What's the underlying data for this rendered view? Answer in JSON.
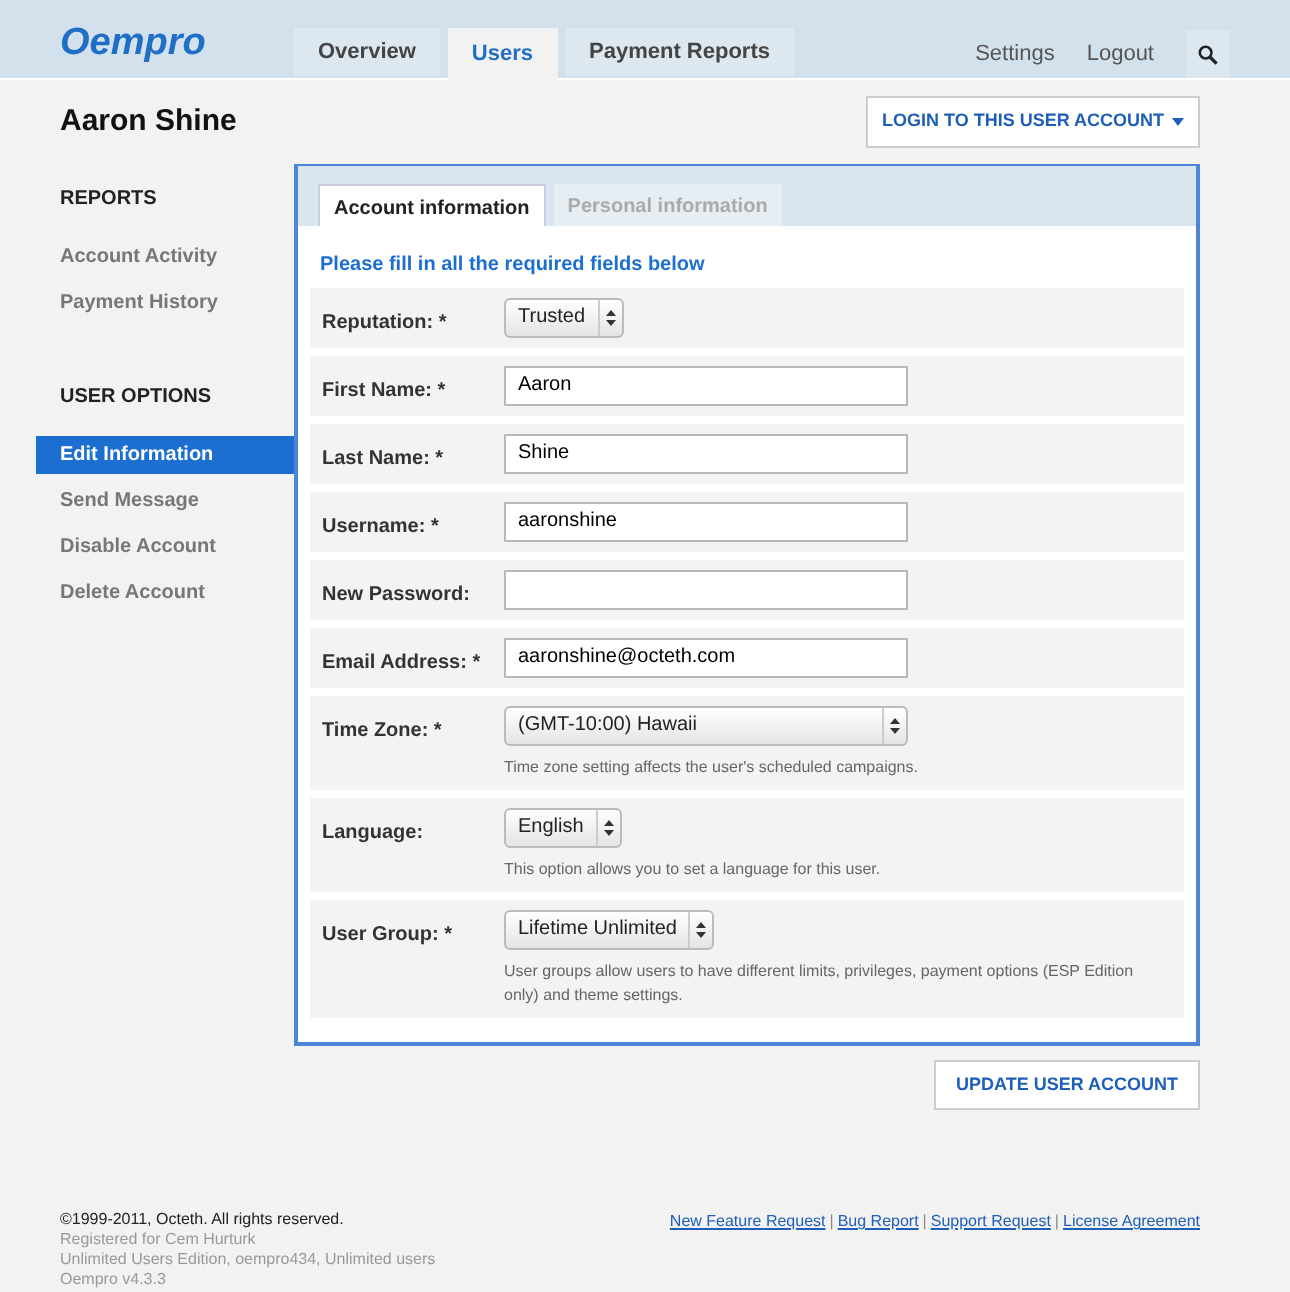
{
  "logo": "Oempro",
  "nav_tabs": [
    {
      "label": "Overview",
      "selected": false
    },
    {
      "label": "Users",
      "selected": true
    },
    {
      "label": "Payment Reports",
      "selected": false
    }
  ],
  "nav_links": [
    "Settings",
    "Logout"
  ],
  "page_title": "Aaron Shine",
  "login_button": "LOGIN TO THIS USER ACCOUNT",
  "sidebar": [
    {
      "heading": "REPORTS",
      "items": [
        {
          "label": "Account Activity",
          "selected": false
        },
        {
          "label": "Payment History",
          "selected": false
        }
      ]
    },
    {
      "heading": "USER OPTIONS",
      "items": [
        {
          "label": "Edit Information",
          "selected": true
        },
        {
          "label": "Send Message",
          "selected": false
        },
        {
          "label": "Disable Account",
          "selected": false
        },
        {
          "label": "Delete Account",
          "selected": false
        }
      ]
    }
  ],
  "form_tabs": [
    {
      "label": "Account information",
      "selected": true
    },
    {
      "label": "Personal information",
      "selected": false
    }
  ],
  "instructions": "Please fill in all the required fields below",
  "fields": [
    {
      "kind": "select",
      "label": "Reputation: *",
      "value": "Trusted"
    },
    {
      "kind": "text",
      "label": "First Name: *",
      "value": "Aaron"
    },
    {
      "kind": "text",
      "label": "Last Name: *",
      "value": "Shine"
    },
    {
      "kind": "text",
      "label": "Username: *",
      "value": "aaronshine"
    },
    {
      "kind": "text",
      "label": "New Password:"
    },
    {
      "kind": "text",
      "label": "Email Address: *",
      "value": "aaronshine@octeth.com"
    },
    {
      "kind": "wideselect",
      "label": "Time Zone: *",
      "value": "(GMT-10:00) Hawaii",
      "help": "Time zone setting affects the user's scheduled campaigns."
    },
    {
      "kind": "select",
      "label": "Language:",
      "value": "English",
      "help": "This option allows you to set a language for this user."
    },
    {
      "kind": "select",
      "label": "User Group: *",
      "value": "Lifetime Unlimited",
      "help": "User groups allow users to have different limits, privileges, payment options (ESP Edition only) and theme settings."
    }
  ],
  "update_button": "UPDATE USER ACCOUNT",
  "footer": {
    "lines": [
      "©1999-2011, Octeth. All rights reserved.",
      "Registered for Cem Hurturk",
      "Unlimited Users Edition, oempro434, Unlimited users",
      "Oempro v4.3.3"
    ],
    "links": [
      "New Feature Request",
      "Bug Report",
      "Support Request",
      "License Agreement"
    ],
    "separator": "|"
  }
}
